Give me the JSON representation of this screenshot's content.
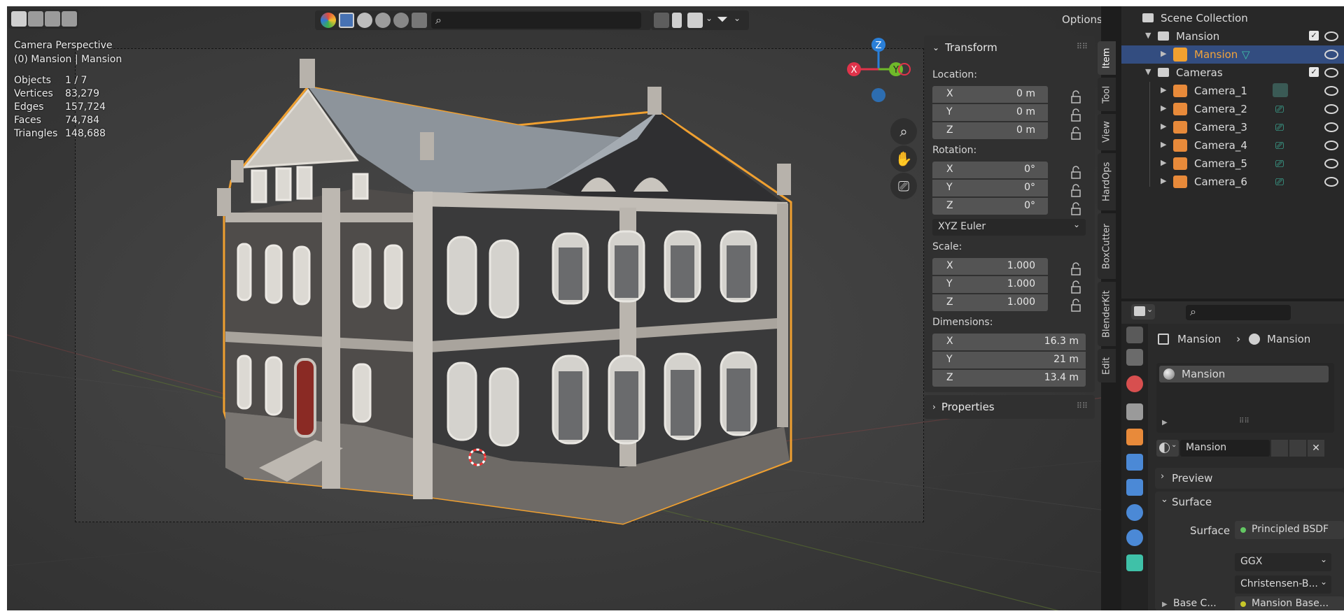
{
  "viewport": {
    "mode_title": "Camera Perspective",
    "object_line": "(0) Mansion | Mansion",
    "stats": [
      {
        "label": "Objects",
        "value": "1 / 7"
      },
      {
        "label": "Vertices",
        "value": "83,279"
      },
      {
        "label": "Edges",
        "value": "157,724"
      },
      {
        "label": "Faces",
        "value": "74,784"
      },
      {
        "label": "Triangles",
        "value": "148,688"
      }
    ],
    "options_label": "Options",
    "gizmo": {
      "z": "Z",
      "x": "X",
      "y": "Y"
    },
    "colors": {
      "x_axis": "#e0334a",
      "y_axis": "#6fb92a",
      "z_axis": "#2a7fd8",
      "selection_outline": "#f0a030"
    }
  },
  "npanel": {
    "transform_title": "Transform",
    "location_label": "Location:",
    "location": [
      {
        "axis": "X",
        "value": "0 m"
      },
      {
        "axis": "Y",
        "value": "0 m"
      },
      {
        "axis": "Z",
        "value": "0 m"
      }
    ],
    "rotation_label": "Rotation:",
    "rotation": [
      {
        "axis": "X",
        "value": "0°"
      },
      {
        "axis": "Y",
        "value": "0°"
      },
      {
        "axis": "Z",
        "value": "0°"
      }
    ],
    "rotation_mode": "XYZ Euler",
    "scale_label": "Scale:",
    "scale": [
      {
        "axis": "X",
        "value": "1.000"
      },
      {
        "axis": "Y",
        "value": "1.000"
      },
      {
        "axis": "Z",
        "value": "1.000"
      }
    ],
    "dimensions_label": "Dimensions:",
    "dimensions": [
      {
        "axis": "X",
        "value": "16.3 m"
      },
      {
        "axis": "Y",
        "value": "21 m"
      },
      {
        "axis": "Z",
        "value": "13.4 m"
      }
    ],
    "properties_title": "Properties",
    "tabs": [
      "Item",
      "Tool",
      "View",
      "HardOps",
      "BoxCutter",
      "BlenderKit",
      "Edit"
    ]
  },
  "outliner": {
    "scene_collection": "Scene Collection",
    "mansion_collection": "Mansion",
    "mansion_object": "Mansion",
    "cameras_collection": "Cameras",
    "cameras": [
      "Camera_1",
      "Camera_2",
      "Camera_3",
      "Camera_4",
      "Camera_5",
      "Camera_6"
    ]
  },
  "properties": {
    "breadcrumb_object": "Mansion",
    "breadcrumb_material": "Mansion",
    "material_slot": "Mansion",
    "material_name": "Mansion",
    "preview_label": "Preview",
    "surface_panel": "Surface",
    "surface_label": "Surface",
    "surface_value": "Principled BSDF",
    "distribution": "GGX",
    "subsurface_method": "Christensen-B...",
    "base_color_label": "Base C...",
    "base_color_value": "Mansion Base..."
  }
}
